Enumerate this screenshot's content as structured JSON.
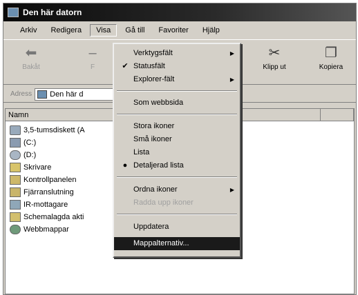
{
  "window": {
    "title": "Den här datorn"
  },
  "menubar": {
    "items": [
      "Arkiv",
      "Redigera",
      "Visa",
      "Gå till",
      "Favoriter",
      "Hjälp"
    ],
    "active": "Visa"
  },
  "toolbar": {
    "back": {
      "label": "Bakåt",
      "icon": "back-arrow-icon"
    },
    "forward": {
      "label": "F",
      "icon": "forward-arrow-icon"
    },
    "cut": {
      "label": "Klipp ut",
      "icon": "scissors-icon"
    },
    "copy": {
      "label": "Kopiera",
      "icon": "copy-icon"
    }
  },
  "address": {
    "label": "Adress",
    "value": "Den här d"
  },
  "list": {
    "header": {
      "name": "Namn"
    },
    "items": [
      {
        "label": "3,5-tumsdiskett (A",
        "icon": "floppy-icon"
      },
      {
        "label": "(C:)",
        "icon": "drive-icon"
      },
      {
        "label": "(D:)",
        "icon": "cdrom-icon"
      },
      {
        "label": "Skrivare",
        "icon": "printer-folder-icon"
      },
      {
        "label": "Kontrollpanelen",
        "icon": "control-panel-icon"
      },
      {
        "label": "Fjärranslutning",
        "icon": "dialup-icon"
      },
      {
        "label": "IR-mottagare",
        "icon": "infrared-icon"
      },
      {
        "label": "Schemalagda akti",
        "icon": "scheduled-tasks-icon"
      },
      {
        "label": "Webbmappar",
        "icon": "web-folders-icon"
      }
    ]
  },
  "viewmenu": {
    "toolbars": "Verktygsfält",
    "statusbar": "Statusfält",
    "explorer_bar": "Explorer-fält",
    "as_web_page": "Som webbsida",
    "large_icons": "Stora ikoner",
    "small_icons": "Små ikoner",
    "list": "Lista",
    "details": "Detaljerad lista",
    "arrange_icons": "Ordna ikoner",
    "line_up_icons": "Radda upp ikoner",
    "refresh": "Uppdatera",
    "folder_options": "Mappalternativ...",
    "check_mark": "✔",
    "radio_mark": "●",
    "submenu_arrow": "▶"
  }
}
